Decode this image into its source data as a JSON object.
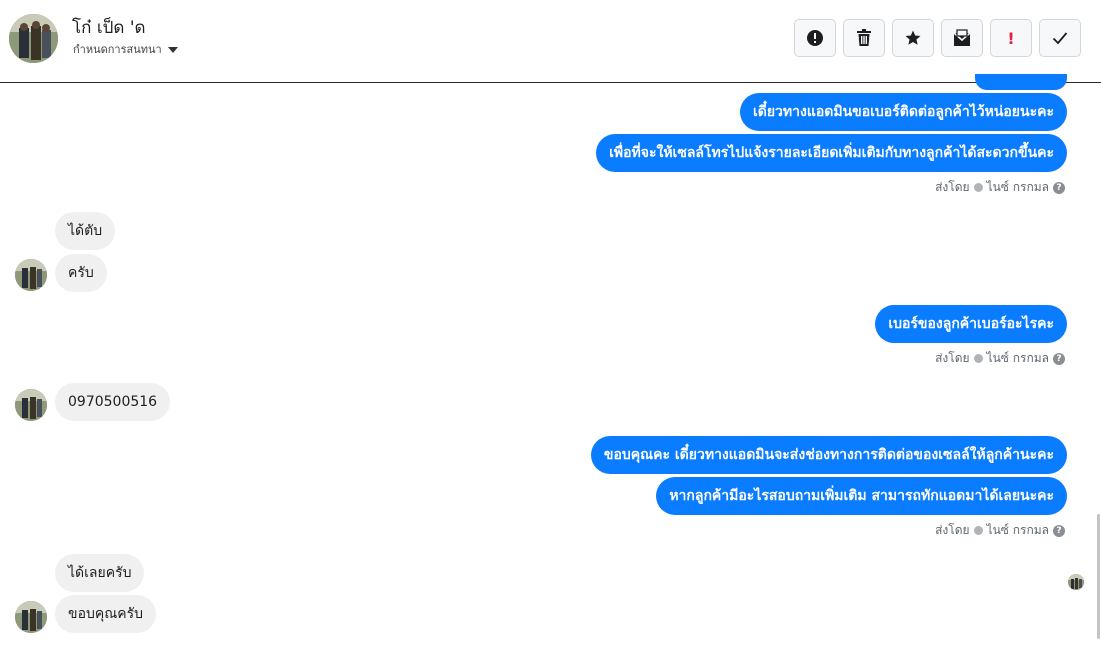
{
  "header": {
    "contact_name": "โก๋ เป็ด 'ด",
    "subtitle": "กำหนดการสนทนา",
    "actions": [
      {
        "name": "report-button",
        "icon": "alert-circle-icon"
      },
      {
        "name": "delete-button",
        "icon": "trash-icon"
      },
      {
        "name": "star-button",
        "icon": "star-icon"
      },
      {
        "name": "mark-unread-button",
        "icon": "envelope-icon"
      },
      {
        "name": "important-button",
        "icon": "exclamation-icon",
        "label": "!"
      },
      {
        "name": "done-button",
        "icon": "check-icon"
      }
    ]
  },
  "messages": {
    "out_1": "เดี๋ยวทางแอดมินขอเบอร์ติดต่อลูกค้าไว้หน่อยนะคะ",
    "out_2": "เพื่อที่จะให้เซลล์โทรไปแจ้งรายละเอียดเพิ่มเติมกับทางลูกค้าได้สะดวกขึ้นคะ",
    "in_1": "ได้ตับ",
    "in_2": "ครับ",
    "out_3": "เบอร์ของลูกค้าเบอร์อะไรคะ",
    "in_3": "0970500516",
    "out_4": "ขอบคุณคะ เดี๋ยวทางแอดมินจะส่งช่องทางการติดต่อของเซลล์ให้ลูกค้านะคะ",
    "out_5": "หากลูกค้ามีอะไรสอบถามเพิ่มเติม สามารถทักแอดมาได้เลยนะคะ",
    "in_4": "ได้เลยครับ",
    "in_5": "ขอบคุณครับ"
  },
  "sent_by": {
    "prefix": "ส่งโดย",
    "sender": "ไนซ์ กรกมล",
    "help": "?"
  },
  "colors": {
    "outgoing_bubble": "#0a7cff",
    "incoming_bubble": "#f0f0f0",
    "important_red": "#e41e3f"
  }
}
